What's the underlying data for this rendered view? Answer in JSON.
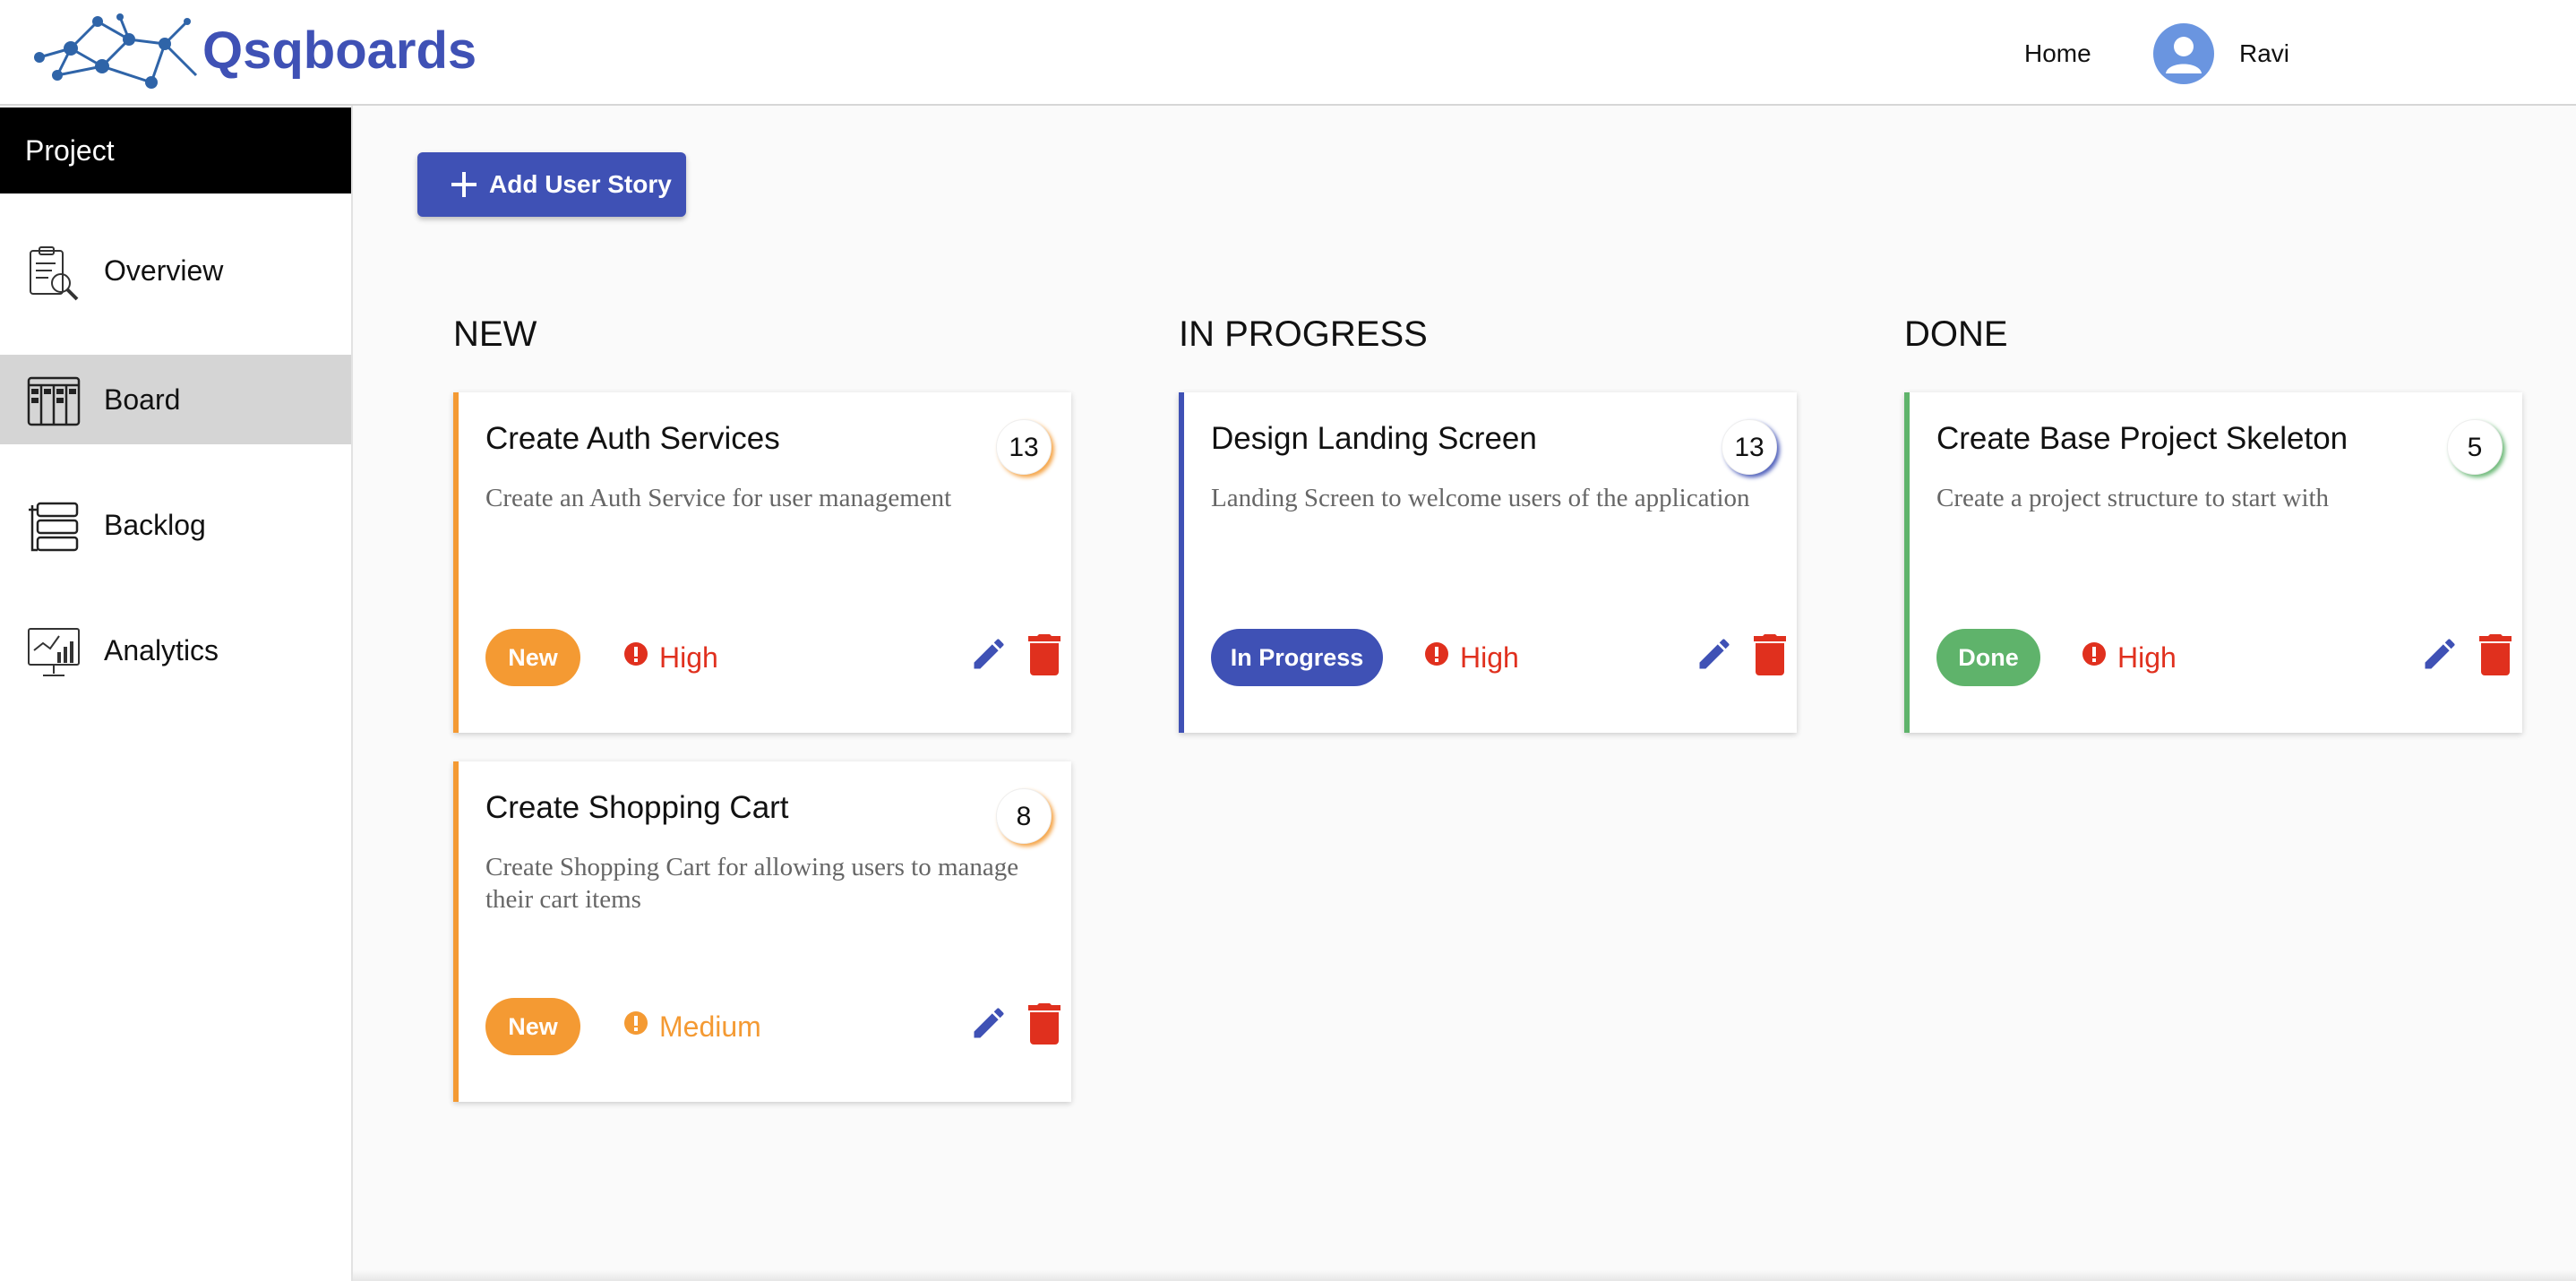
{
  "header": {
    "logo_text": "Qsqboards",
    "nav_home": "Home",
    "user_name": "Ravi"
  },
  "sidebar": {
    "section_title": "Project",
    "items": [
      {
        "label": "Overview",
        "icon": "clipboard-magnifier-icon",
        "active": false
      },
      {
        "label": "Board",
        "icon": "kanban-board-icon",
        "active": true
      },
      {
        "label": "Backlog",
        "icon": "backlog-stack-icon",
        "active": false
      },
      {
        "label": "Analytics",
        "icon": "analytics-chart-icon",
        "active": false
      }
    ]
  },
  "toolbar": {
    "add_story_label": "Add User Story"
  },
  "columns": [
    {
      "title": "NEW",
      "cards": [
        {
          "title": "Create Auth Services",
          "points": "13",
          "description": "Create an Auth Service for user management",
          "status": "New",
          "priority": "High"
        },
        {
          "title": "Create Shopping Cart",
          "points": "8",
          "description": "Create Shopping Cart for allowing users to manage their cart items",
          "status": "New",
          "priority": "Medium"
        }
      ]
    },
    {
      "title": "IN PROGRESS",
      "cards": [
        {
          "title": "Design Landing Screen",
          "points": "13",
          "description": "Landing Screen to welcome users of the application",
          "status": "In Progress",
          "priority": "High"
        }
      ]
    },
    {
      "title": "DONE",
      "cards": [
        {
          "title": "Create Base Project Skeleton",
          "points": "5",
          "description": "Create a project structure to start with",
          "status": "Done",
          "priority": "High"
        }
      ]
    }
  ],
  "colors": {
    "primary": "#3f51b5",
    "new": "#f49a33",
    "done": "#5fb36b",
    "high": "#e0301e",
    "medium": "#f49a33"
  }
}
